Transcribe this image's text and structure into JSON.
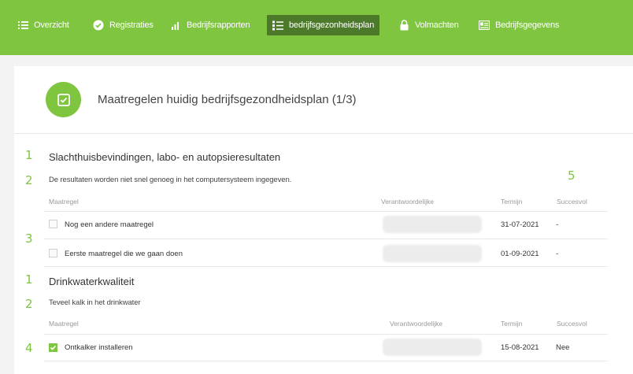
{
  "nav": {
    "items": [
      {
        "label": "Overzicht",
        "icon": "list-icon"
      },
      {
        "label": "Registraties",
        "icon": "check-circle-icon"
      },
      {
        "label": "Bedrijfsrapporten",
        "icon": "bar-chart-icon"
      },
      {
        "label": "bedrijfsgezonheidsplan",
        "icon": "checklist-icon",
        "active": true
      },
      {
        "label": "Volmachten",
        "icon": "lock-icon"
      },
      {
        "label": "Bedrijfsgegevens",
        "icon": "card-icon"
      }
    ]
  },
  "header": {
    "title": "Maatregelen huidig bedrijfsgezondheidsplan (1/3)"
  },
  "annotations": {
    "a1": "1",
    "a2": "2",
    "a3": "3",
    "a5": "5",
    "b1": "1",
    "b2": "2",
    "b4": "4"
  },
  "columns": {
    "measure": "Maatregel",
    "responsible": "Verantwoordelijke",
    "term": "Termijn",
    "success": "Succesvol"
  },
  "sections": [
    {
      "title": "Slachthuisbevindingen, labo- en autopsieresultaten",
      "description": "De resultaten worden niet snel genoeg in het computersysteem ingegeven.",
      "rows": [
        {
          "label": "Nog een andere maatregel",
          "date": "31-07-2021",
          "status": "-",
          "checked": false
        },
        {
          "label": "Eerste maatregel die we gaan doen",
          "date": "01-09-2021",
          "status": "-",
          "checked": false
        }
      ]
    },
    {
      "title": "Drinkwaterkwaliteit",
      "description": "Teveel kalk in het drinkwater",
      "rows": [
        {
          "label": "Ontkalker installeren",
          "date": "15-08-2021",
          "status": "Nee",
          "checked": true
        }
      ]
    }
  ],
  "colors": {
    "accent": "#80c540",
    "active_nav": "#4d7a2a"
  }
}
